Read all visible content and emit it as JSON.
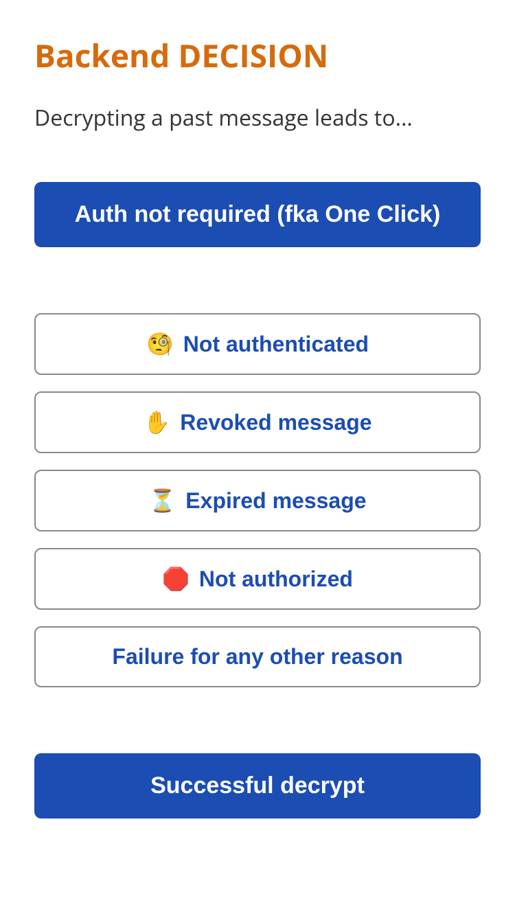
{
  "header": {
    "title": "Backend DECISION",
    "subtitle": "Decrypting a past message leads to..."
  },
  "primaryTop": {
    "label": "Auth not required (fka One Click)"
  },
  "options": [
    {
      "icon": "🧐",
      "label": "Not authenticated"
    },
    {
      "icon": "✋",
      "label": "Revoked message"
    },
    {
      "icon": "⏳",
      "label": "Expired message"
    },
    {
      "icon": "🛑",
      "label": "Not authorized"
    },
    {
      "icon": "",
      "label": "Failure for any other reason"
    }
  ],
  "primaryBottom": {
    "label": "Successful decrypt"
  }
}
